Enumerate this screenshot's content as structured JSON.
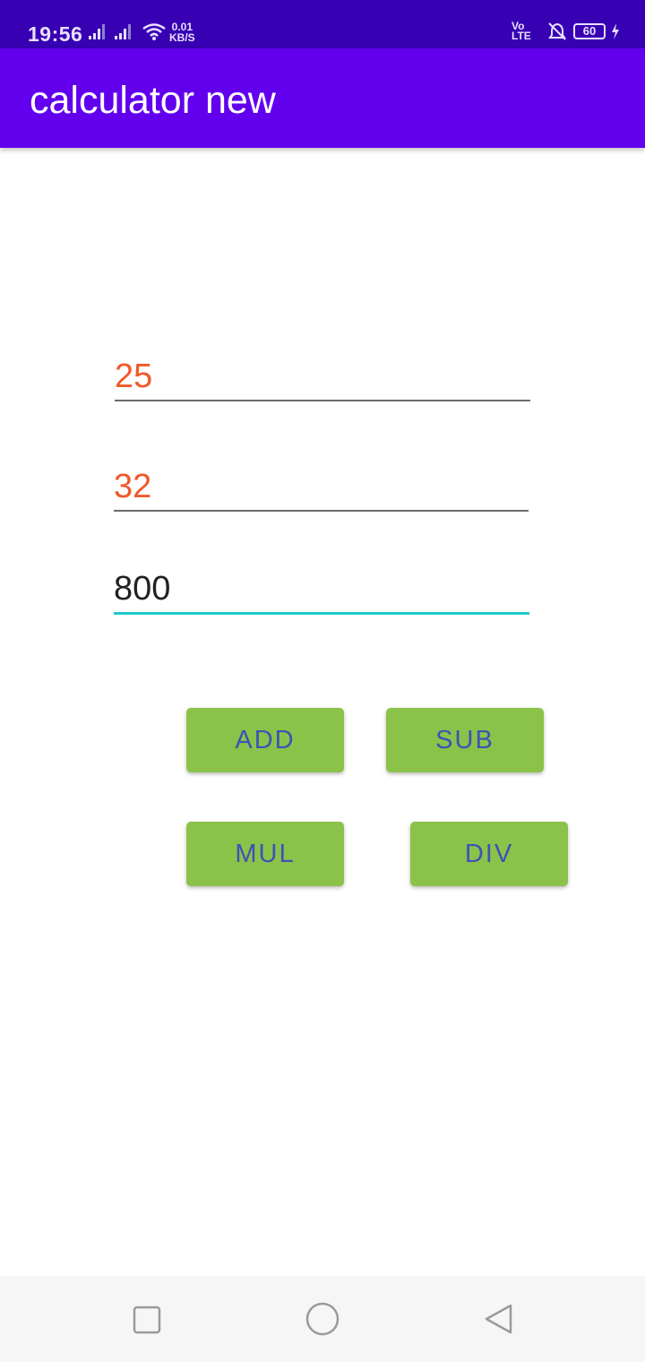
{
  "status_bar": {
    "time": "19:56",
    "net_speed_value": "0.01",
    "net_speed_unit": "KB/S",
    "volte_top": "Vo",
    "volte_bottom": "LTE",
    "battery": "60",
    "icons": [
      "signal-icon",
      "signal-icon",
      "wifi-icon",
      "volte-icon",
      "bell-off-icon",
      "battery-icon",
      "charging-icon"
    ]
  },
  "app_bar": {
    "title": "calculator new"
  },
  "inputs": {
    "first_number": "25",
    "second_number": "32",
    "result": "800"
  },
  "buttons": {
    "add": "ADD",
    "sub": "SUB",
    "mul": "MUL",
    "div": "DIV"
  },
  "colors": {
    "status_bar": "#3700b3",
    "app_bar": "#6200ee",
    "input_text": "#ef5a2a",
    "result_text": "#212121",
    "focus_underline": "#1fc8c8",
    "button_bg": "#8bc34a",
    "button_text": "#3f51b5"
  },
  "nav_bar": {
    "icons": [
      "recents-square-icon",
      "home-circle-icon",
      "back-triangle-icon"
    ]
  }
}
